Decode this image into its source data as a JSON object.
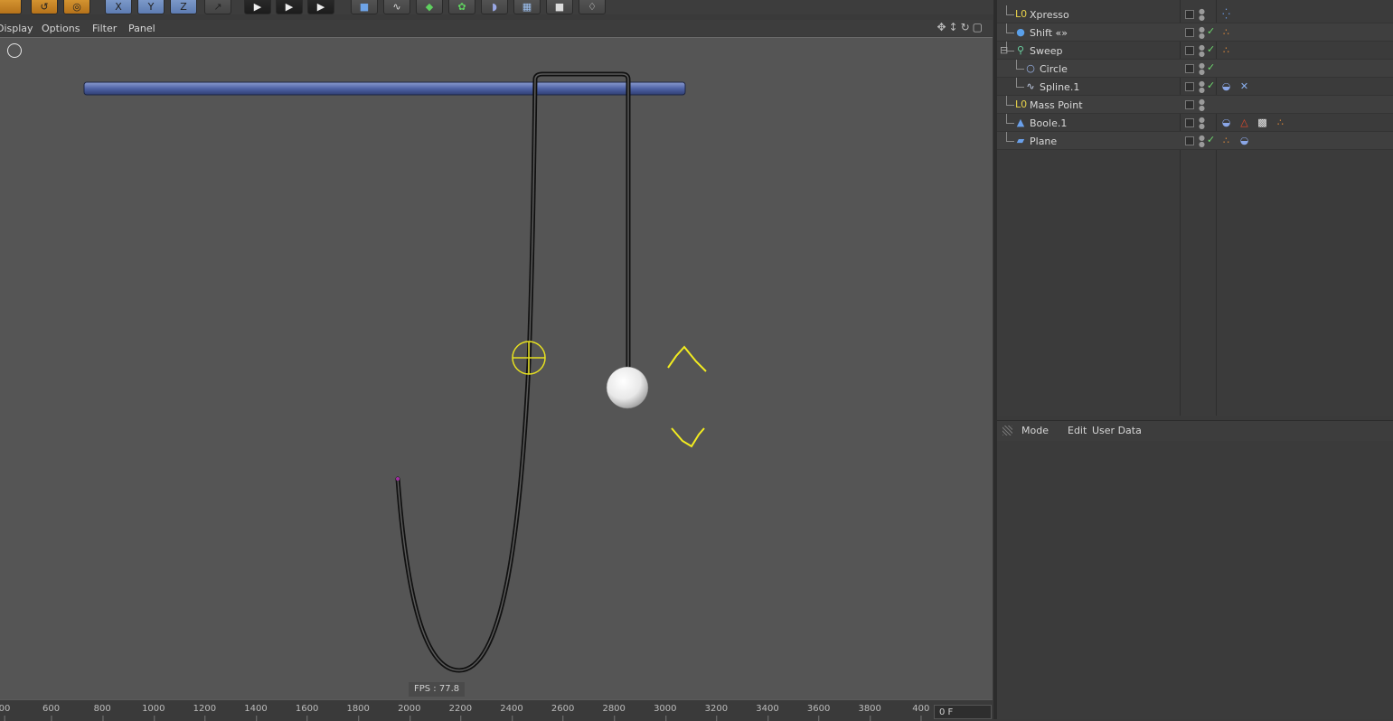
{
  "toolbar": {
    "buttons": [
      {
        "icon": "layout-icon"
      },
      {
        "icon": "undo-icon"
      },
      {
        "icon": "live-select-icon"
      },
      {
        "icon": "x-axis-lock-icon",
        "label": "X"
      },
      {
        "icon": "y-axis-lock-icon",
        "label": "Y"
      },
      {
        "icon": "z-axis-lock-icon",
        "label": "Z"
      },
      {
        "icon": "coordinate-system-icon"
      },
      {
        "icon": "render-view-icon"
      },
      {
        "icon": "render-picture-viewer-icon"
      },
      {
        "icon": "render-settings-icon"
      },
      {
        "icon": "cube-icon"
      },
      {
        "icon": "spline-pen-icon"
      },
      {
        "icon": "subdivision-icon"
      },
      {
        "icon": "array-icon"
      },
      {
        "icon": "deformer-icon"
      },
      {
        "icon": "floor-icon"
      },
      {
        "icon": "camera-icon"
      },
      {
        "icon": "light-icon"
      }
    ]
  },
  "viewport": {
    "menu": [
      "Display",
      "Options",
      "Filter",
      "Panel"
    ],
    "fps_label": "FPS : 77.8"
  },
  "timeline": {
    "ticks": [
      "00",
      "600",
      "800",
      "1000",
      "1200",
      "1400",
      "1600",
      "1800",
      "2000",
      "2200",
      "2400",
      "2600",
      "2800",
      "3000",
      "3200",
      "3400",
      "3600",
      "3800",
      "400"
    ],
    "frame_value": "0 F"
  },
  "objects": [
    {
      "name": "Xpresso",
      "icon": "null-object-icon",
      "indent": 1,
      "check": false,
      "tags": [
        "xpresso-tag-icon"
      ]
    },
    {
      "name": "Shift «»",
      "icon": "sphere-icon",
      "indent": 1,
      "check": true,
      "tags": [
        "material-tag-icon"
      ]
    },
    {
      "name": "Sweep",
      "icon": "sweep-icon",
      "indent": 1,
      "check": true,
      "tags": [
        "material-tag-icon"
      ],
      "expanded": true
    },
    {
      "name": "Circle",
      "icon": "circle-spline-icon",
      "indent": 2,
      "check": true,
      "tags": []
    },
    {
      "name": "Spline.1",
      "icon": "spline-icon",
      "indent": 2,
      "check": true,
      "tags": [
        "phong-tag-icon",
        "pin-tag-icon"
      ]
    },
    {
      "name": "Mass Point",
      "icon": "null-object-icon",
      "indent": 1,
      "check": false,
      "tags": []
    },
    {
      "name": "Boole.1",
      "icon": "boole-icon",
      "indent": 1,
      "check": false,
      "tags": [
        "phong-tag-icon",
        "warning-tag-icon",
        "checker-material-icon",
        "material-tag-icon"
      ]
    },
    {
      "name": "Plane",
      "icon": "plane-icon",
      "indent": 1,
      "check": true,
      "tags": [
        "material-tag-icon",
        "phong-tag-icon"
      ]
    }
  ],
  "attributes": {
    "menu": [
      "Mode",
      "Edit",
      "User Data"
    ]
  }
}
